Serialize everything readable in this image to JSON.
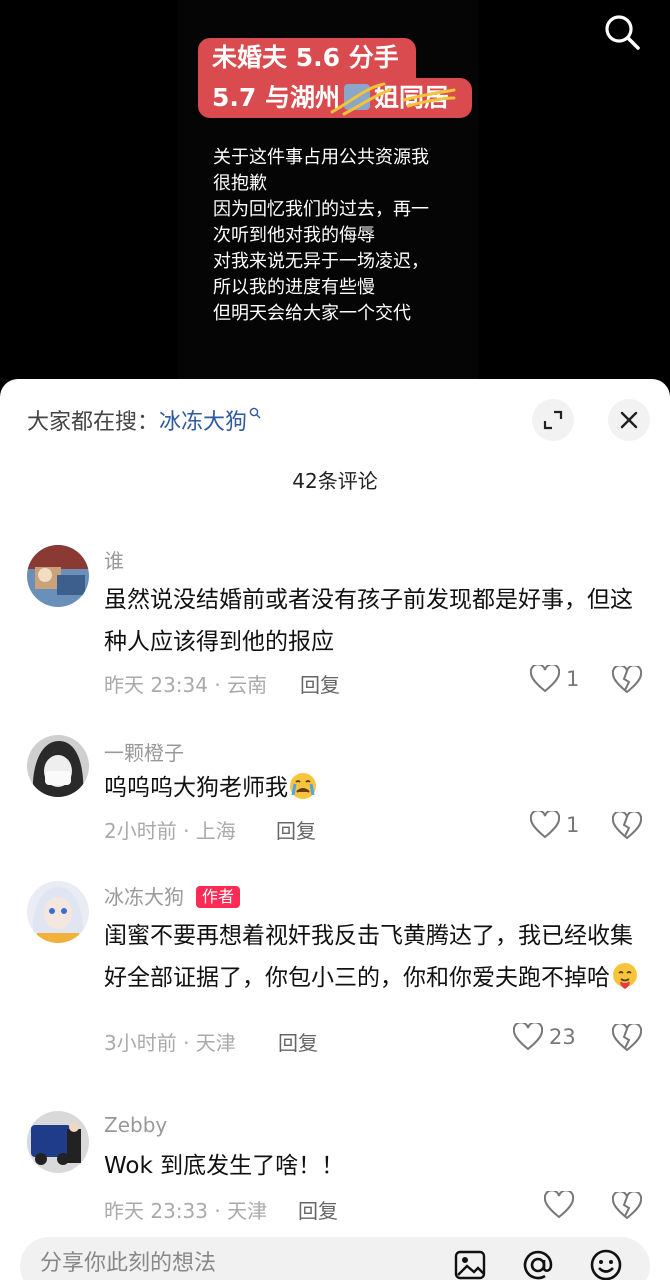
{
  "video": {
    "title_line1": "未婚夫 5.6 分手",
    "title_line2": "5.7 与湖州",
    "title_line2_tail": "姐同居",
    "overlay_lines": [
      "关于这件事占用公共资源我",
      "很抱歉",
      "因为回忆我们的过去，再一",
      "次听到他对我的侮辱",
      "对我来说无异于一场凌迟，",
      "所以我的进度有些慢",
      "但明天会给大家一个交代"
    ]
  },
  "sheet": {
    "trending_prefix": "大家都在搜：",
    "trending_keyword": "冰冻大狗",
    "comment_count": "42条评论"
  },
  "comments": [
    {
      "name": "谁",
      "text": "虽然说没结婚前或者没有孩子前发现都是好事，但这种人应该得到他的报应",
      "meta": "昨天 23:34 · 云南",
      "reply": "回复",
      "likes": "1"
    },
    {
      "name": "一颗橙子",
      "text": "呜呜呜大狗老师我",
      "meta": "2小时前 · 上海",
      "reply": "回复",
      "likes": "1"
    },
    {
      "name": "冰冻大狗",
      "author_tag": "作者",
      "text": "闺蜜不要再想着视奸我反击飞黄腾达了，我已经收集好全部证据了，你包小三的，你和你爱夫跑不掉哈",
      "meta": "3小时前 · 天津",
      "reply": "回复",
      "likes": "23"
    },
    {
      "name": "Zebby",
      "text": "Wok 到底发生了啥！！",
      "meta": "昨天 23:33 · 天津",
      "reply": "回复",
      "likes": ""
    }
  ],
  "input": {
    "placeholder": "分享你此刻的想法"
  },
  "colors": {
    "title_bg": "#d94b4f",
    "author_tag": "#fe2c55",
    "keyword": "#2f5aa0"
  }
}
